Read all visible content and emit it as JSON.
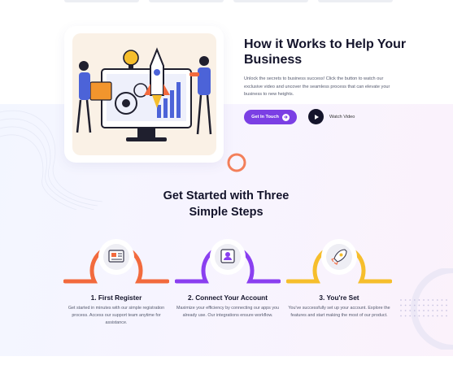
{
  "hero": {
    "title": "How it Works to Help Your Business",
    "description": "Unlock the secrets to business success! Click the button to watch our exclusive video and uncover the seamless process that can elevate your business to new heights.",
    "cta_label": "Get In Touch",
    "video_label": "Watch Video"
  },
  "steps_section": {
    "title": "Get Started with Three Simple Steps",
    "steps": [
      {
        "name": "1. First Register",
        "description": "Get started in minutes with our simple registration process. Access our support team anytime for assistance.",
        "icon": "registration-form-icon",
        "color": "#f26a3d"
      },
      {
        "name": "2. Connect Your Account",
        "description": "Maximize your efficiency by connecting our apps you already use. Our integrations ensure workflow.",
        "icon": "account-connect-icon",
        "color": "#8a3ff0"
      },
      {
        "name": "3. You're Set",
        "description": "You've successfully set up your account. Explore the features and start making the most of our product.",
        "icon": "rocket-icon",
        "color": "#f6be2c"
      }
    ]
  },
  "colors": {
    "accent": "#7b3fe4",
    "dark": "#14142b",
    "illustration_bg": "#faf1e6"
  }
}
